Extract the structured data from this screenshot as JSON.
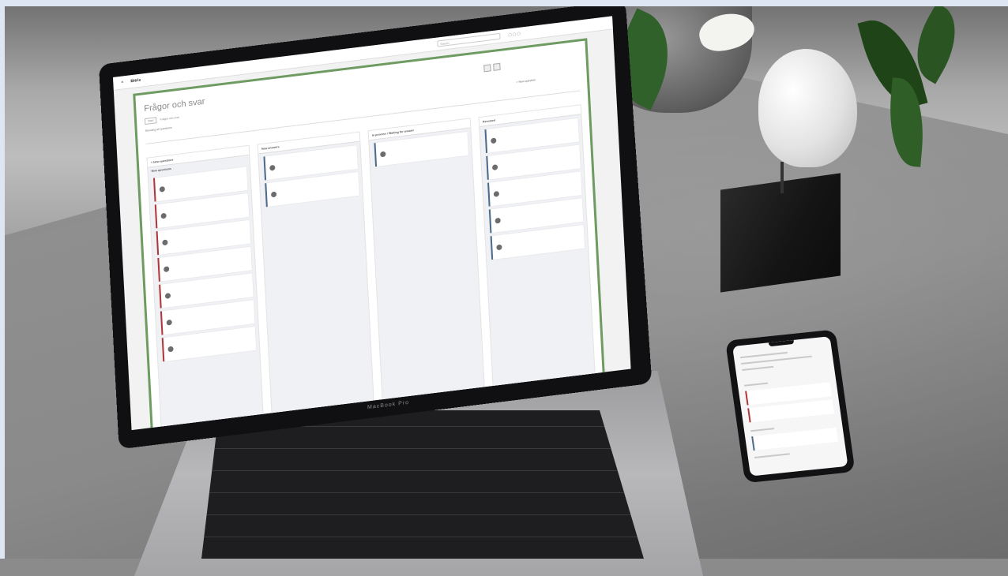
{
  "app": {
    "logo_text": "Bitrix",
    "search_placeholder": "Search"
  },
  "page": {
    "title": "Frågor och svar",
    "breadcrumb": [
      "Start",
      "Frågor och svar"
    ],
    "status": "Showing all questions",
    "new_question_label": "+ New question"
  },
  "columns": [
    {
      "title": "+ New questions",
      "subtitle": "New questions",
      "accent": "#b0353a"
    },
    {
      "title": "New answers",
      "accent": "#4a6b8a"
    },
    {
      "title": "In process / Waiting for answer",
      "accent": "#4a6b8a"
    },
    {
      "title": "Resolved",
      "accent": "#4a6b8a"
    }
  ],
  "device": {
    "laptop_brand": "MacBook Pro"
  }
}
